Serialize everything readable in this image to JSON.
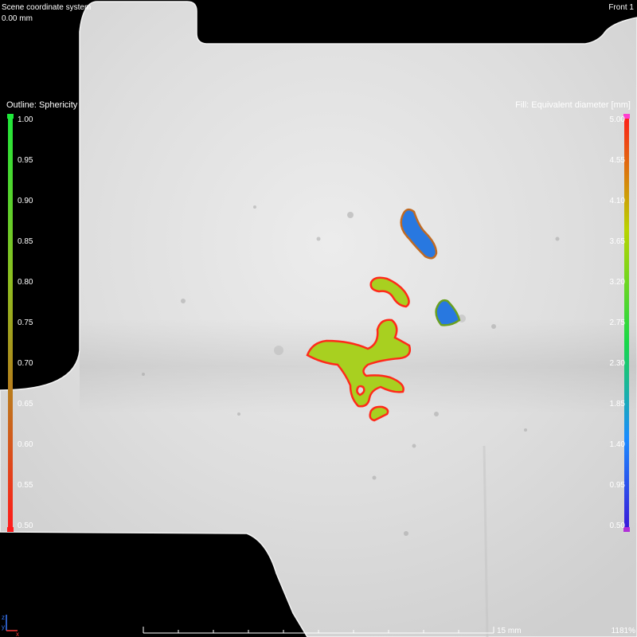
{
  "hud": {
    "coordinate_system": "Scene coordinate system",
    "offset": "0.00 mm",
    "view_name": "Front 1",
    "scale_label": "15 mm",
    "zoom_readout": "1181%"
  },
  "outline_legend": {
    "title": "Outline: Sphericity",
    "ticks": [
      "1.00",
      "0.95",
      "0.90",
      "0.85",
      "0.80",
      "0.75",
      "0.70",
      "0.65",
      "0.60",
      "0.55",
      "0.50"
    ],
    "colors": {
      "top": "#1ee83a",
      "middle": "#b08a1c",
      "bottom": "#ff1a1a"
    }
  },
  "fill_legend": {
    "title": "Fill: Equivalent diameter [mm]",
    "ticks": [
      "5.00",
      "4.55",
      "4.10",
      "3.65",
      "3.20",
      "2.75",
      "2.30",
      "1.85",
      "1.40",
      "0.95",
      "0.50"
    ],
    "colors": {
      "top": "#ff1a1a",
      "upper": "#b8d400",
      "middle": "#18d848",
      "lower": "#1a8cff",
      "bottom": "#3a18d8",
      "cap_top": "#ff3fd0",
      "cap_bottom": "#b030d8"
    }
  },
  "defects": [
    {
      "fill": "#2878e0",
      "outline": "#c06a22"
    },
    {
      "fill": "#2878e0",
      "outline": "#6aa020"
    },
    {
      "fill": "#a8d020",
      "outline": "#ff2a1a"
    },
    {
      "fill": "#a8d020",
      "outline": "#ff2a1a"
    },
    {
      "fill": "#a8d020",
      "outline": "#ff2a1a"
    }
  ]
}
